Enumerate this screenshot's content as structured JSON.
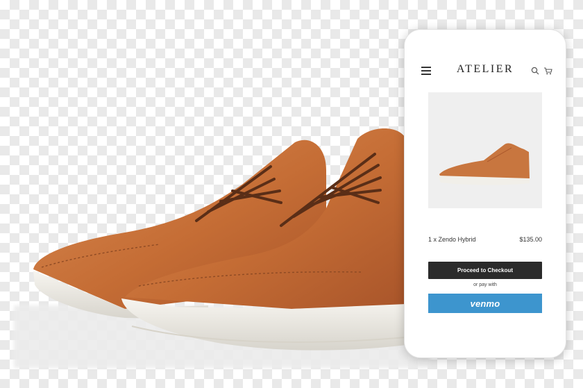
{
  "app": {
    "brand": "ATELIER"
  },
  "header_icons": [
    "menu-icon",
    "search-icon",
    "cart-icon"
  ],
  "cart_item": {
    "name": "1 x Zendo Hybrid",
    "price": "$135.00"
  },
  "checkout": {
    "proceed_label": "Proceed to Checkout",
    "alt_label": "or pay with",
    "venmo_label": "venmo"
  },
  "colors": {
    "checkout_button": "#2b2b2b",
    "venmo_button": "#3d95ce",
    "shoe_leather": "#c8763f"
  }
}
